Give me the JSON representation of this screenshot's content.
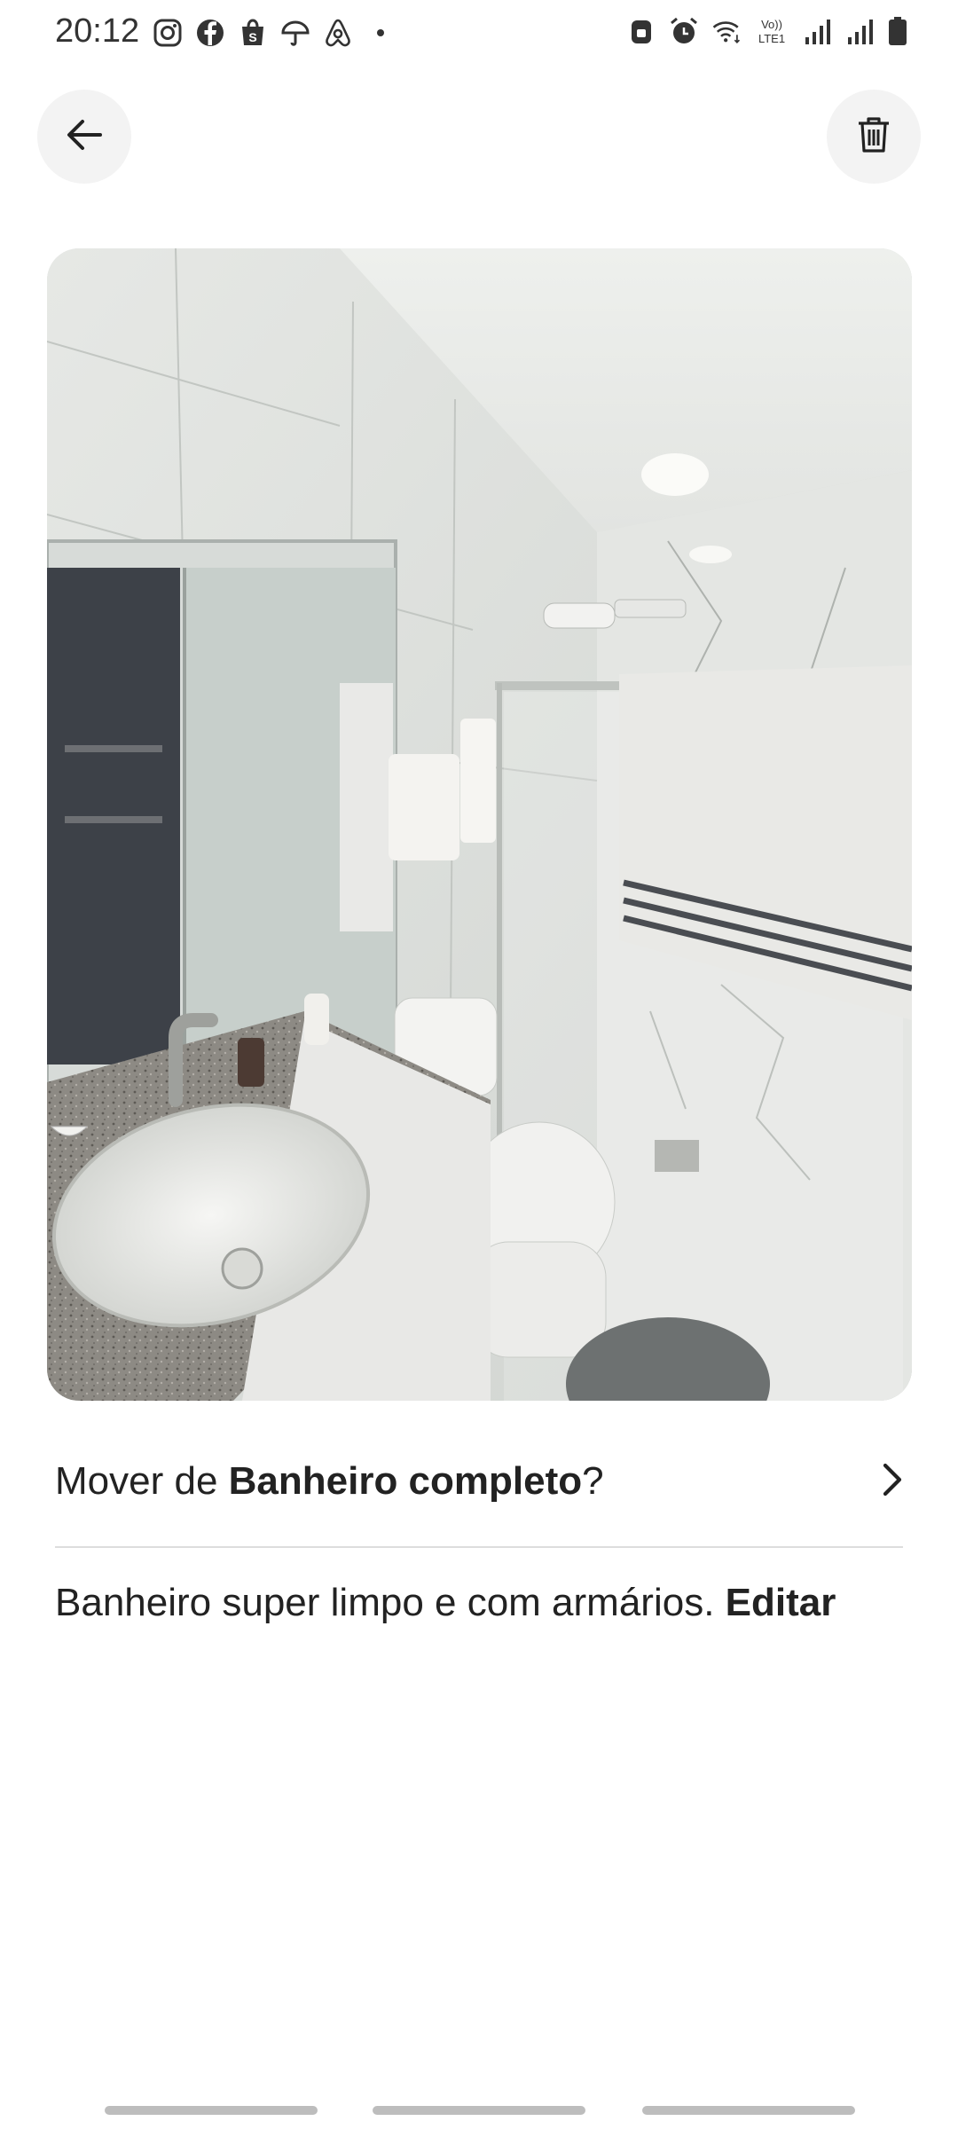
{
  "status_bar": {
    "time": "20:12",
    "left_icons": [
      "instagram-icon",
      "facebook-icon",
      "shopee-icon",
      "umbrella-icon",
      "airbnb-icon",
      "dot-icon"
    ],
    "right_icons": [
      "lock-icon",
      "alarm-icon",
      "wifi-icon",
      "volte-icon",
      "signal-icon",
      "signal-icon",
      "battery-icon"
    ],
    "volte_label": "Vo)) LTE1"
  },
  "nav": {
    "back_icon": "arrow-left-icon",
    "delete_icon": "trash-icon"
  },
  "photo": {
    "subject": "bathroom-photo"
  },
  "move": {
    "prefix": "Mover de ",
    "room": "Banheiro completo",
    "suffix": "?",
    "chevron_icon": "chevron-right-icon"
  },
  "caption": {
    "text": "Banheiro super limpo e com armários.",
    "edit_label": "Editar"
  }
}
